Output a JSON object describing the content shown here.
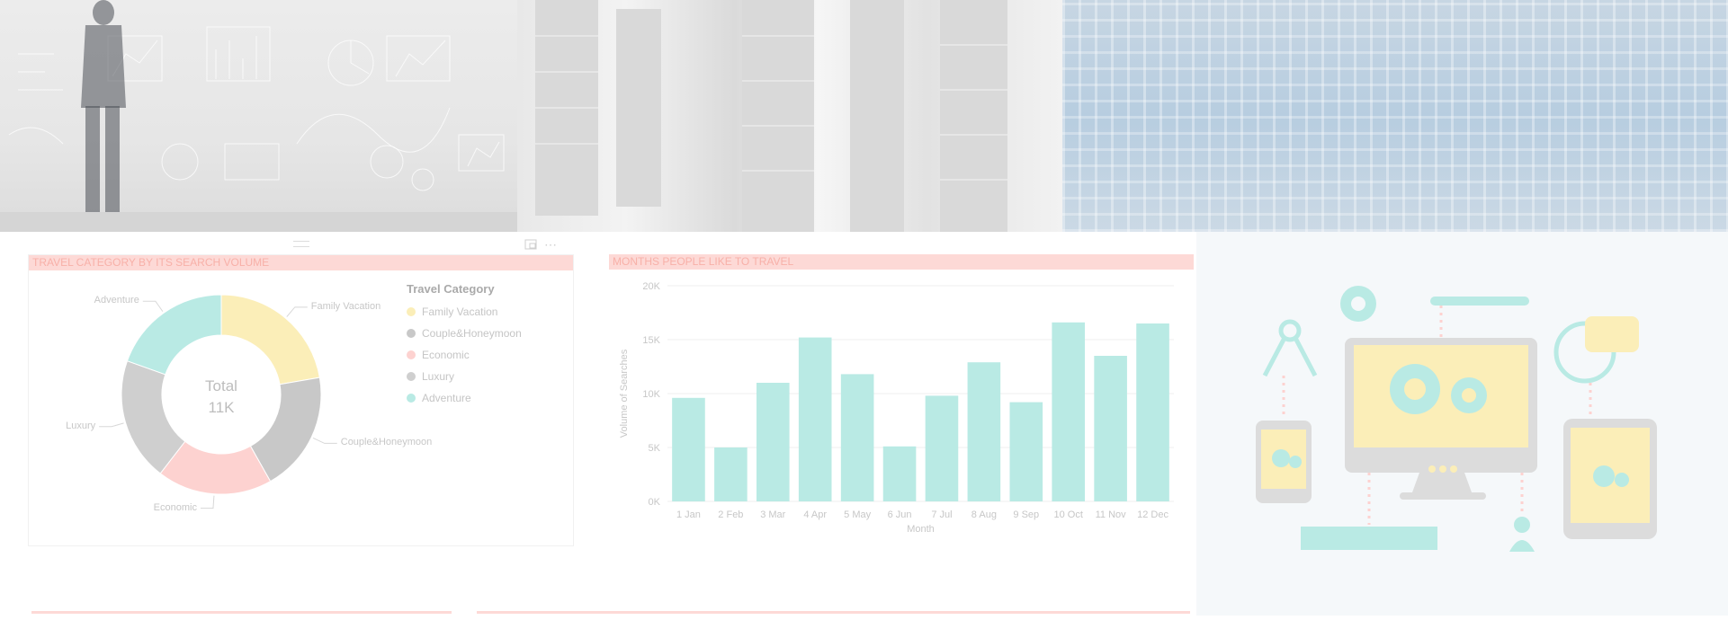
{
  "donut_card": {
    "title": "TRAVEL CATEGORY BY ITS SEARCH VOLUME",
    "center_label": "Total",
    "center_value": "11K",
    "legend_title": "Travel Category"
  },
  "bar_card": {
    "title": "MONTHS PEOPLE LIKE TO TRAVEL"
  },
  "chart_data": [
    {
      "type": "pie",
      "title": "TRAVEL CATEGORY BY ITS SEARCH VOLUME",
      "center_text": "Total 11K",
      "legend_title": "Travel Category",
      "categories": [
        "Family Vacation",
        "Couple&Honeymoon",
        "Economic",
        "Luxury",
        "Adventure"
      ],
      "values": [
        2450,
        2150,
        2050,
        2200,
        2150
      ],
      "colors": [
        "#fbeeb8",
        "#c8c8c8",
        "#fdd2d0",
        "#cfcfcf",
        "#b9eae4"
      ],
      "legend_placement": "right"
    },
    {
      "type": "bar",
      "title": "MONTHS PEOPLE LIKE TO TRAVEL",
      "xlabel": "Month",
      "ylabel": "Volume of Searches",
      "categories": [
        "1 Jan",
        "2 Feb",
        "3 Mar",
        "4 Apr",
        "5 May",
        "6 Jun",
        "7 Jul",
        "8 Aug",
        "9 Sep",
        "10 Oct",
        "11 Nov",
        "12 Dec"
      ],
      "values": [
        9600,
        5000,
        11000,
        15200,
        11800,
        5100,
        9800,
        12900,
        9200,
        16600,
        13500,
        16500
      ],
      "ylim": [
        0,
        20000
      ],
      "yticks": [
        "0K",
        "5K",
        "10K",
        "15K",
        "20K"
      ],
      "color": "#b9eae4",
      "grid": true
    }
  ],
  "colors": {
    "title_bar_bg": "#fdd9d6",
    "title_text": "#f8b0a8",
    "bar_color": "#b9eae4"
  }
}
